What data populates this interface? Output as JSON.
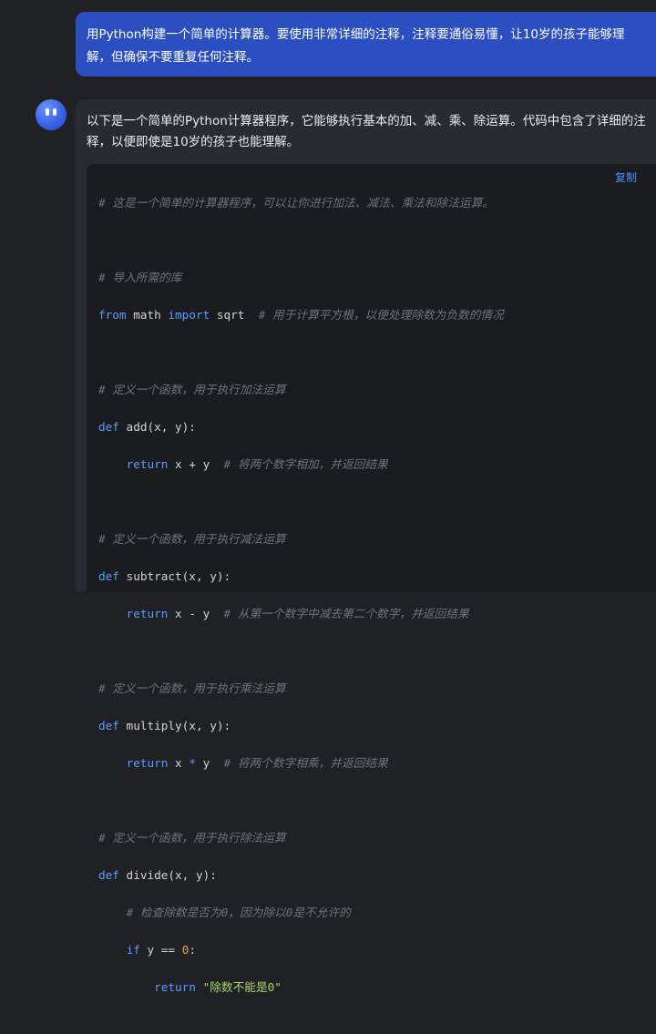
{
  "user_message": {
    "text": "用Python构建一个简单的计算器。要使用非常详细的注释，注释要通俗易懂，让10岁的孩子能够理解，但确保不要重复任何注释。"
  },
  "assistant": {
    "intro": "以下是一个简单的Python计算器程序，它能够执行基本的加、减、乘、除运算。代码中包含了详细的注释，以便即使是10岁的孩子也能理解。",
    "copy_label": "复制",
    "code": {
      "l1_comment": "# 这是一个简单的计算器程序，可以让你进行加法、减法、乘法和除法运算。",
      "l3_comment": "# 导入所需的库",
      "l4_from": "from",
      "l4_mod": " math ",
      "l4_import": "import",
      "l4_name": " sqrt  ",
      "l4_comment": "# 用于计算平方根，以便处理除数为负数的情况",
      "l6_comment": "# 定义一个函数，用于执行加法运算",
      "l7_def": "def",
      "l7_sig": " add(x, y):",
      "l8_return": "return",
      "l8_expr": " x + y  ",
      "l8_comment": "# 将两个数字相加，并返回结果",
      "l10_comment": "# 定义一个函数，用于执行减法运算",
      "l11_def": "def",
      "l11_sig": " subtract(x, y):",
      "l12_return": "return",
      "l12_expr": " x - y  ",
      "l12_comment": "# 从第一个数字中减去第二个数字，并返回结果",
      "l14_comment": "# 定义一个函数，用于执行乘法运算",
      "l15_def": "def",
      "l15_sig": " multiply(x, y):",
      "l16_return": "return",
      "l16_x": " x ",
      "l16_op": "*",
      "l16_y": " y  ",
      "l16_comment": "# 将两个数字相乘，并返回结果",
      "l18_comment": "# 定义一个函数，用于执行除法运算",
      "l19_def": "def",
      "l19_sig": " divide(x, y):",
      "l20_comment": "# 检查除数是否为0，因为除以0是不允许的",
      "l21_if": "if",
      "l21_cond": " y == ",
      "l21_num": "0",
      "l21_colon": ":",
      "l22_return": "return",
      "l22_str": " \"除数不能是0\""
    }
  },
  "colors": {
    "user_bubble": "#2b4fc0",
    "keyword": "#5a9cff",
    "comment": "#6f7278",
    "number": "#e8a64e",
    "copy_link": "#4a8cff"
  }
}
